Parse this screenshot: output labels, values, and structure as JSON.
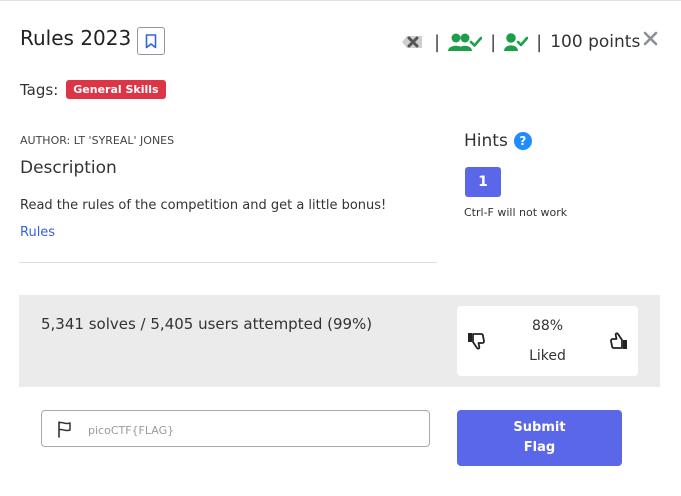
{
  "challenge": {
    "title": "Rules 2023",
    "points_text": "100 points",
    "separator": "|",
    "tags_label": "Tags:",
    "tags": [
      "General Skills"
    ],
    "author": "AUTHOR: LT 'SYREAL' JONES",
    "description_heading": "Description",
    "description": "Read the rules of the competition and get a little bonus!",
    "link_text": "Rules"
  },
  "hints": {
    "heading": "Hints",
    "help_symbol": "?",
    "button_label": "1",
    "hint_text": "Ctrl-F will not work"
  },
  "stats": {
    "solves_text": "5,341 solves / 5,405 users attempted (99%)",
    "liked_percent": "88%",
    "liked_label": "Liked"
  },
  "flag": {
    "placeholder": "picoCTF{FLAG}",
    "submit_label": "Submit Flag"
  },
  "icons": {
    "bookmark": "bookmark-icon",
    "not_solved": "x-mark-icon",
    "users_solved": "users-check-icon",
    "user_solved": "user-check-icon",
    "close": "close-icon",
    "flag": "flag-icon",
    "thumbs_down": "thumbs-down-icon",
    "thumbs_up": "thumbs-up-icon"
  },
  "colors": {
    "primary": "#5a67e8",
    "tag_red": "#dc3545",
    "success_green": "#1e9e4a",
    "link_blue": "#3563d8",
    "help_blue": "#1f8cff",
    "panel_gray": "#ebebeb"
  }
}
